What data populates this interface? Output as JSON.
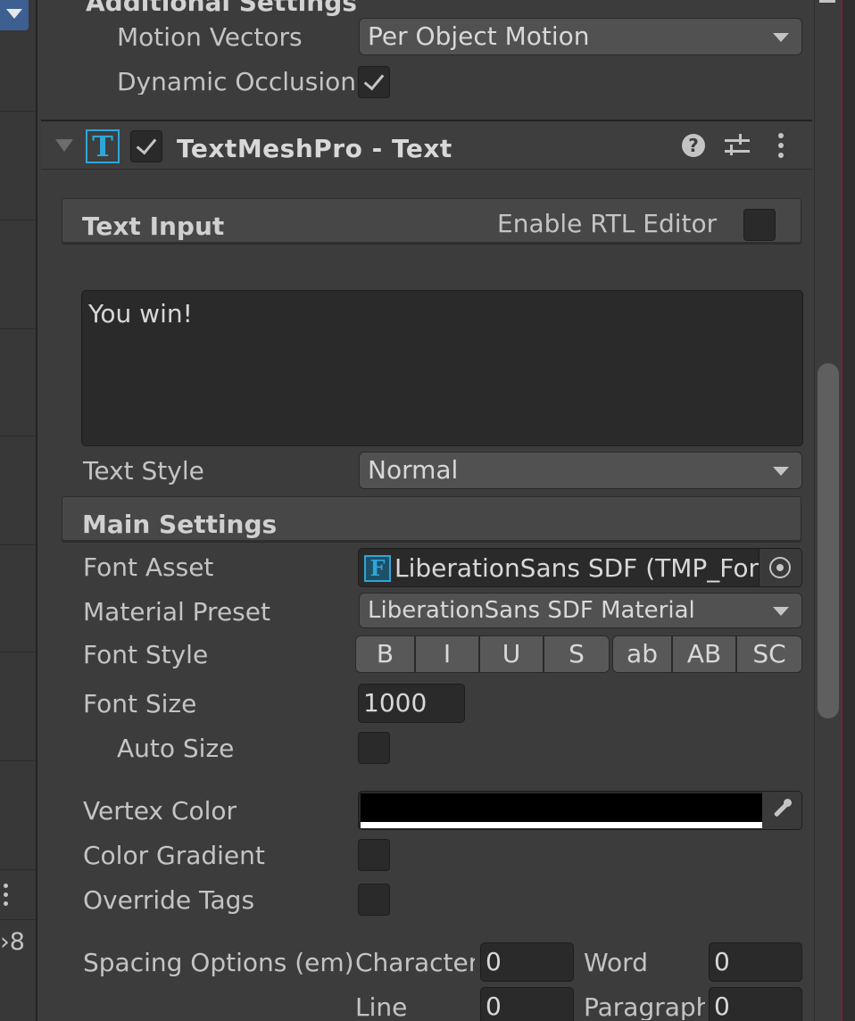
{
  "top": {
    "section_title": "Additional Settings",
    "motion_vectors": {
      "label": "Motion Vectors",
      "value": "Per Object Motion"
    },
    "dynamic_occlusion": {
      "label": "Dynamic Occlusion",
      "checked": true
    }
  },
  "component": {
    "title": "TextMeshPro - Text",
    "icon": "T",
    "enabled": true
  },
  "text_input": {
    "header": "Text Input",
    "rtl_label": "Enable RTL Editor",
    "rtl_checked": false,
    "text": "You win!",
    "text_style_label": "Text Style",
    "text_style_value": "Normal"
  },
  "main_settings": {
    "header": "Main Settings",
    "font_asset_label": "Font Asset",
    "font_asset_icon": "F",
    "font_asset_value": "LiberationSans SDF (TMP_Font Asset)",
    "material_preset_label": "Material Preset",
    "material_preset_value": "LiberationSans SDF Material",
    "font_style_label": "Font Style",
    "font_style_buttons": [
      "B",
      "I",
      "U",
      "S",
      "ab",
      "AB",
      "SC"
    ],
    "font_size_label": "Font Size",
    "font_size_value": "1000",
    "auto_size_label": "Auto Size",
    "vertex_color_label": "Vertex Color",
    "vertex_color": "#000000",
    "color_gradient_label": "Color Gradient",
    "override_tags_label": "Override Tags",
    "spacing_label": "Spacing Options (em)",
    "character_label": "Character",
    "character_value": "0",
    "word_label": "Word",
    "word_value": "0",
    "line_label": "Line",
    "line_value": "0",
    "paragraph_label": "Paragraph",
    "paragraph_value": "0"
  },
  "left_panel": {
    "partial_text": "›8"
  }
}
